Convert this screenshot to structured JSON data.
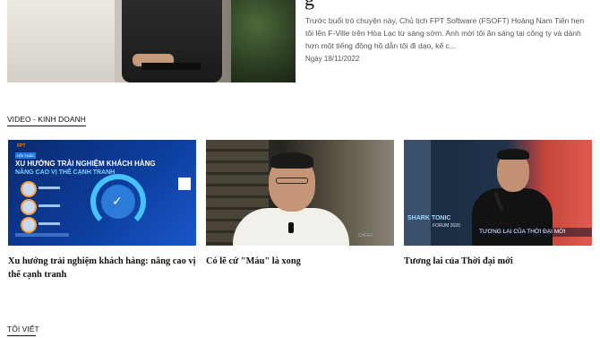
{
  "hero": {
    "title_fragment": "g",
    "description": "Trước buổi trò chuyện này, Chủ tịch FPT Software (FSOFT) Hoàng Nam Tiến hẹn tôi lên F-Ville trên Hòa Lạc từ sáng sớm. Anh mời tôi ăn sáng tại công ty và dành hơn một tiếng đồng hồ dẫn tôi đi dạo, kể c...",
    "date": "Ngày 18/11/2022"
  },
  "sections": {
    "video": "VIDEO - KINH DOANH",
    "toi_viet": "TÔI VIẾT"
  },
  "videos": [
    {
      "title": "Xu hướng trải nghiệm khách hàng: nâng cao vị thế cạnh tranh",
      "thumb_text": {
        "brand": "FPT",
        "tag": "HỘI THẢO",
        "line1": "XU HƯỚNG TRẢI NGHIỆM KHÁCH HÀNG",
        "line2": "NÂNG CAO VỊ THẾ CẠNH TRANH"
      }
    },
    {
      "title": "Có lẽ cứ \"Máu\" là xong",
      "thumb_text": {
        "logo": "CAFEF"
      }
    },
    {
      "title": "Tương lai của Thời đại mới",
      "thumb_text": {
        "show": "SHARK TONIC",
        "forum": "FORUM 2020",
        "caption": "TƯƠNG LAI CỦA THỜI ĐẠI MỚI"
      }
    }
  ],
  "colors": {
    "accent_blue": "#0c3d9c",
    "accent_red": "#c7453d",
    "text": "#111111",
    "muted": "#555555"
  }
}
